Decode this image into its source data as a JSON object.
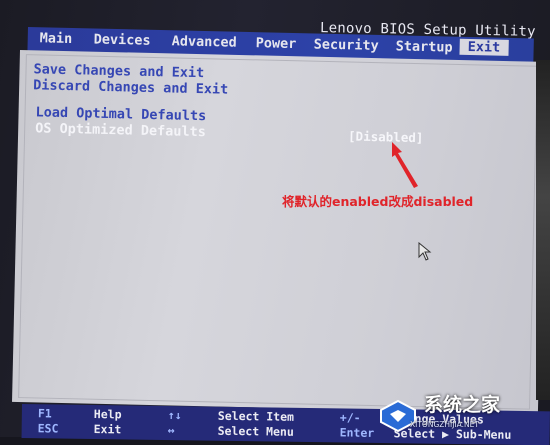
{
  "bios": {
    "title": "Lenovo BIOS Setup Utility"
  },
  "menubar": {
    "tabs": [
      {
        "label": "Main"
      },
      {
        "label": "Devices"
      },
      {
        "label": "Advanced"
      },
      {
        "label": "Power"
      },
      {
        "label": "Security"
      },
      {
        "label": "Startup"
      },
      {
        "label": "Exit",
        "active": true
      }
    ]
  },
  "exit_menu": {
    "items": [
      {
        "label": "Save Changes and Exit"
      },
      {
        "label": "Discard Changes and Exit"
      },
      {
        "label": "Load Optimal Defaults"
      },
      {
        "label": "OS Optimized Defaults",
        "value": "[Disabled]",
        "selected": true
      }
    ]
  },
  "annotation": {
    "text": "将默认的enabled改成disabled",
    "color": "#e0242a"
  },
  "footer": {
    "rows": [
      [
        {
          "key": "F1",
          "desc": "Help"
        },
        {
          "key": "↑↓",
          "desc": "Select Item"
        },
        {
          "key": "+/-",
          "desc": "Change Values"
        }
      ],
      [
        {
          "key": "ESC",
          "desc": "Exit"
        },
        {
          "key": "↔",
          "desc": "Select Menu"
        },
        {
          "key": "Enter",
          "desc": "Select ▶ Sub-Menu"
        }
      ]
    ]
  },
  "watermark": {
    "text": "系统之家",
    "url": "XITONGZHIJIA.NET"
  },
  "colors": {
    "menubar": "#2d42a8",
    "panel": "#d0d0d6",
    "item_text": "#3647b4",
    "footer": "#252a78"
  }
}
